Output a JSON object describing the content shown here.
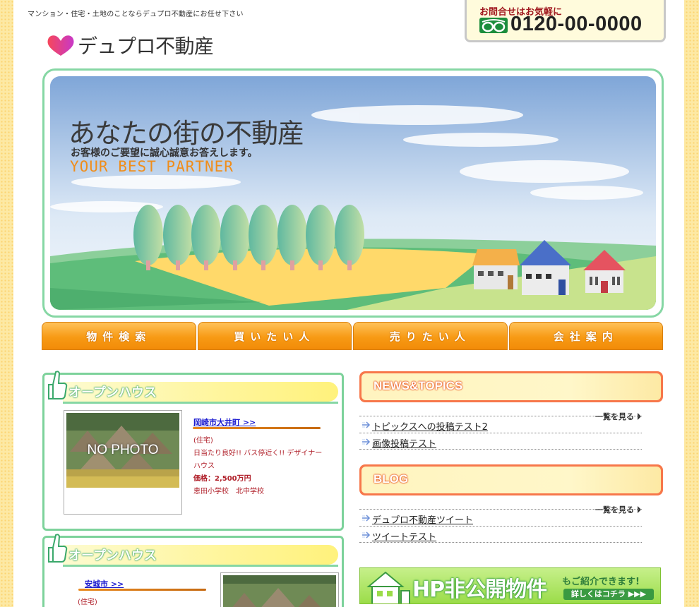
{
  "header": {
    "tagline": "マンション・住宅・土地のことならデュプロ不動産にお任せ下さい",
    "logo_text": "デュプロ不動産",
    "contact_label": "お問合せはお気軽に",
    "phone": "0120-00-0000"
  },
  "hero": {
    "title": "あなたの街の不動産",
    "subtitle": "お客様のご要望に誠心誠意お答えします。",
    "english": "YOUR BEST PARTNER"
  },
  "nav": [
    {
      "label": "物件検索"
    },
    {
      "label": "買いたい人"
    },
    {
      "label": "売りたい人"
    },
    {
      "label": "会社案内"
    }
  ],
  "open_houses": [
    {
      "heading": "オープンハウス",
      "photo_label": "NO PHOTO",
      "link": "岡崎市大井町 >>",
      "category": "(住宅)",
      "description": "日当たり良好!! バス停近く!! デザイナーハウス",
      "price": "価格：2,500万円",
      "schools": "恵田小学校　北中学校"
    },
    {
      "heading": "オープンハウス",
      "link": "安城市 >>",
      "category": "(住宅)"
    }
  ],
  "news": {
    "heading": "NEWS&TOPICS",
    "more": "一覧を見る",
    "items": [
      "トピックスへの投稿テスト2",
      "画像投稿テスト"
    ]
  },
  "blog": {
    "heading": "BLOG",
    "more": "一覧を見る",
    "items": [
      "デュプロ不動産ツイート",
      "ツイートテスト"
    ]
  },
  "banner": {
    "main": "HP非公開物件",
    "sub": "もご紹介できます!",
    "button": "詳しくはコチラ ▶▶▶"
  },
  "colors": {
    "accent_orange": "#f79a14",
    "frame_green": "#86d7a4",
    "news_red": "#f7774a",
    "link_blue": "#1b1bd0"
  }
}
